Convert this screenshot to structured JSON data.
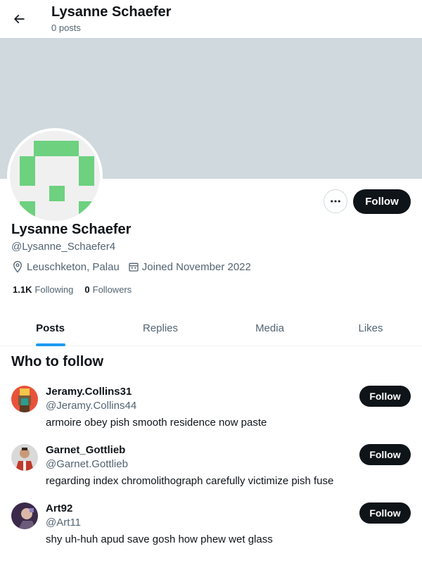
{
  "header": {
    "title": "Lysanne Schaefer",
    "post_count": "0 posts"
  },
  "profile": {
    "display_name": "Lysanne Schaefer",
    "handle": "@Lysanne_Schaefer4",
    "location": "Leuschketon, Palau",
    "joined": "Joined November 2022",
    "following_count": "1.1K",
    "following_label": "Following",
    "followers_count": "0",
    "followers_label": "Followers",
    "follow_label": "Follow",
    "banner_color": "#cfd9de",
    "avatar_color": "#6dd17f"
  },
  "tabs": [
    {
      "label": "Posts",
      "active": true
    },
    {
      "label": "Replies",
      "active": false
    },
    {
      "label": "Media",
      "active": false
    },
    {
      "label": "Likes",
      "active": false
    }
  ],
  "who_to_follow": {
    "title": "Who to follow",
    "items": [
      {
        "name": "Jeramy.Collins31",
        "handle": "@Jeramy.Collins44",
        "bio": "armoire obey pish smooth residence now paste",
        "follow_label": "Follow"
      },
      {
        "name": "Garnet_Gottlieb",
        "handle": "@Garnet.Gottlieb",
        "bio": "regarding index chromolithograph carefully victimize pish fuse",
        "follow_label": "Follow"
      },
      {
        "name": "Art92",
        "handle": "@Art11",
        "bio": "shy uh-huh apud save gosh how phew wet glass",
        "follow_label": "Follow"
      }
    ]
  },
  "colors": {
    "accent": "#1d9bf0",
    "text_primary": "#0f1419",
    "text_secondary": "#536471",
    "button_dark": "#0f1419"
  }
}
